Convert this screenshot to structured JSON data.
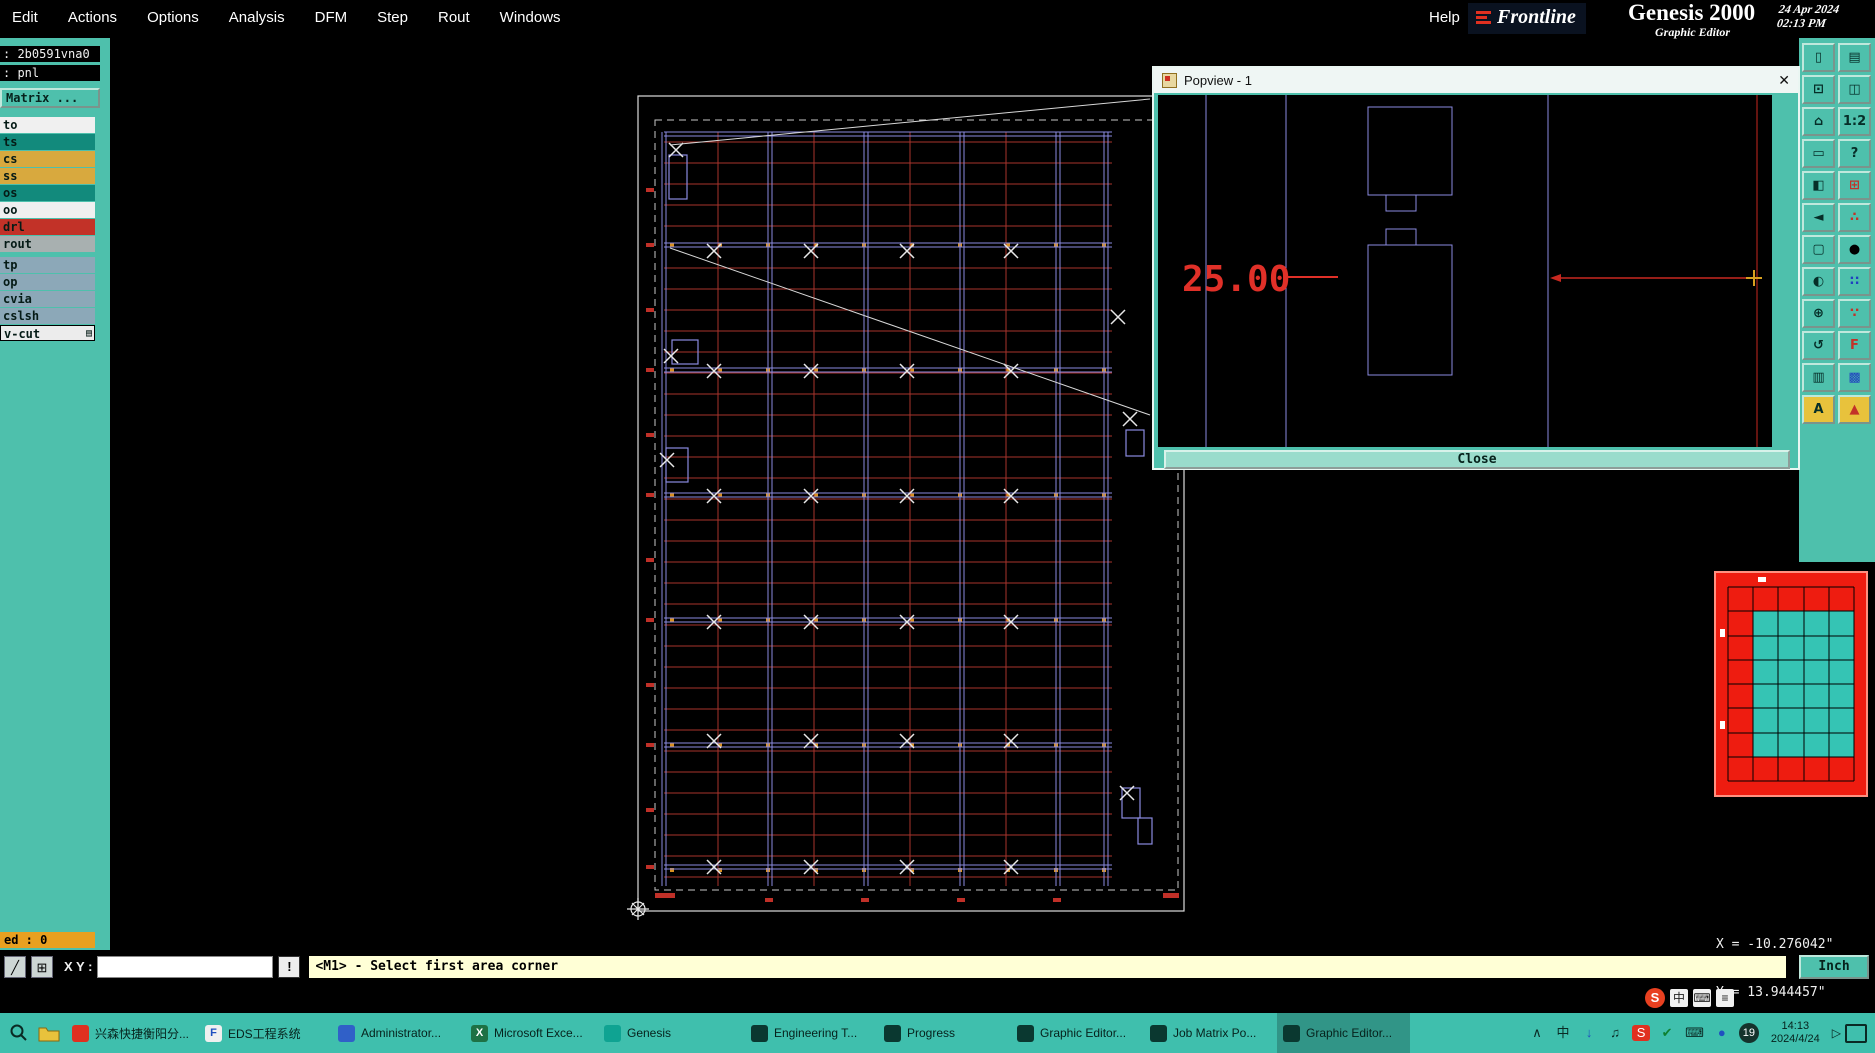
{
  "menu_bar": {
    "items": [
      "Edit",
      "Actions",
      "Options",
      "Analysis",
      "DFM",
      "Step",
      "Rout",
      "Windows"
    ],
    "help": "Help",
    "brand": "Frontline",
    "app_title": "Genesis 2000",
    "date": "24 Apr 2024",
    "time": "02:13 PM",
    "subtitle": "Graphic Editor"
  },
  "sidebar": {
    "job": ": 2b0591vna0",
    "step": ": pnl",
    "matrix_button": "Matrix ...",
    "layers": [
      {
        "label": "to",
        "bg": "#F0F0F0"
      },
      {
        "label": "ts",
        "bg": "#128A7C"
      },
      {
        "label": "cs",
        "bg": "#D8A93E"
      },
      {
        "label": "ss",
        "bg": "#D8A93E"
      },
      {
        "label": "os",
        "bg": "#128A7C"
      },
      {
        "label": "oo",
        "bg": "#F0F0F0"
      },
      {
        "label": "drl",
        "bg": "#C23228"
      },
      {
        "label": "rout",
        "bg": "#A8B0B0"
      },
      {
        "label": "tp",
        "bg": "#8CA8B8"
      },
      {
        "label": "op",
        "bg": "#8CA8B8"
      },
      {
        "label": "cvia",
        "bg": "#8CA8B8"
      },
      {
        "label": "cslsh",
        "bg": "#8CA8B8"
      },
      {
        "label": "v-cut",
        "bg": "#ECECEC"
      }
    ],
    "counter": "ed : 0"
  },
  "popview": {
    "title": "Popview - 1",
    "close_x": "✕",
    "dimension": "25.00",
    "close_button": "Close"
  },
  "status_bar": {
    "icons": [
      {
        "glyph": "╱"
      },
      {
        "glyph": "⊞"
      }
    ],
    "xy_label": "X Y :",
    "input_value": "",
    "alert": "!",
    "message": "<M1> - Select first area corner",
    "units": "Inch"
  },
  "coords": {
    "x": "X = -10.276042\"",
    "y": "Y = 13.944457\""
  },
  "right_toolbar": {
    "icons": [
      {
        "glyph": "▯",
        "fg": "#062E28"
      },
      {
        "glyph": "▤",
        "fg": "#062E28"
      },
      {
        "glyph": "⊡",
        "fg": "#062E28"
      },
      {
        "glyph": "◫",
        "fg": "#062E28"
      },
      {
        "glyph": "⌂",
        "fg": "#062E28"
      },
      {
        "glyph": "1:2",
        "fg": "#062E28"
      },
      {
        "glyph": "▭",
        "fg": "#062E28"
      },
      {
        "glyph": "?",
        "fg": "#062E28"
      },
      {
        "glyph": "◧",
        "fg": "#062E28"
      },
      {
        "glyph": "⊞",
        "fg": "#C23228"
      },
      {
        "glyph": "◄",
        "fg": "#062E28"
      },
      {
        "glyph": "∴",
        "fg": "#C23228"
      },
      {
        "glyph": "▢",
        "fg": "#062E28"
      },
      {
        "glyph": "●",
        "fg": "#000000"
      },
      {
        "glyph": "◐",
        "fg": "#062E28"
      },
      {
        "glyph": "∷",
        "fg": "#2040C0"
      },
      {
        "glyph": "⊕",
        "fg": "#062E28"
      },
      {
        "glyph": "∵",
        "fg": "#C23228"
      },
      {
        "glyph": "↺",
        "fg": "#062E28"
      },
      {
        "glyph": "F",
        "fg": "#C23228"
      },
      {
        "glyph": "▥",
        "fg": "#062E28"
      },
      {
        "glyph": "▩",
        "fg": "#2040C0"
      },
      {
        "glyph": "A",
        "fg": "#062E28",
        "bg": "#E8C23C"
      },
      {
        "glyph": "▲",
        "fg": "#C23228",
        "bg": "#E8C23C"
      }
    ]
  },
  "taskbar": {
    "items": [
      {
        "label": "兴森快捷衡阳分...",
        "icon_color": "#E03020",
        "icon_letter": "",
        "bg": "transparent"
      },
      {
        "label": "EDS工程系统",
        "icon_color": "#F0F0F0",
        "icon_letter": "F",
        "letter_color": "#2050C0",
        "bg": "transparent"
      },
      {
        "label": "Administrator...",
        "icon_color": "#3060C8",
        "icon_letter": "",
        "bg": "transparent"
      },
      {
        "label": "Microsoft Exce...",
        "icon_color": "#1E7145",
        "icon_letter": "X",
        "letter_color": "#FFFFFF",
        "bg": "transparent"
      },
      {
        "label": "Genesis",
        "icon_color": "#0FA392",
        "icon_letter": "",
        "bg": "transparent"
      },
      {
        "label": "Engineering T...",
        "icon_color": "#0A3830",
        "icon_letter": "",
        "bg": "transparent"
      },
      {
        "label": "Progress",
        "icon_color": "#0A3830",
        "icon_letter": "",
        "bg": "transparent"
      },
      {
        "label": "Graphic Editor...",
        "icon_color": "#0A3830",
        "icon_letter": "",
        "bg": "transparent"
      },
      {
        "label": "Job Matrix Po...",
        "icon_color": "#0A3830",
        "icon_letter": "",
        "bg": "transparent"
      },
      {
        "label": "Graphic Editor...",
        "icon_color": "#0A3830",
        "icon_letter": "",
        "bg": "rgba(0,0,0,0.22)"
      }
    ],
    "tray": [
      {
        "glyph": "∧",
        "fg": "#0A2A24",
        "bg": "transparent"
      },
      {
        "glyph": "中",
        "fg": "#0A2A24",
        "bg": "transparent"
      },
      {
        "glyph": "↓",
        "fg": "#2050C0",
        "bg": "transparent"
      },
      {
        "glyph": "♫",
        "fg": "#0A2A24",
        "bg": "transparent"
      },
      {
        "glyph": "S",
        "fg": "#FFFFFF",
        "bg": "#E03020"
      },
      {
        "glyph": "✔",
        "fg": "#0E8030",
        "bg": "transparent"
      },
      {
        "glyph": "⌨",
        "fg": "#0A2A24",
        "bg": "transparent"
      },
      {
        "glyph": "●",
        "fg": "#2050C0",
        "bg": "transparent"
      }
    ],
    "badge": "19",
    "time": "14:13",
    "date": "2024/4/24",
    "play": "▷"
  },
  "ime": {
    "logo": "S",
    "icons": [
      {
        "glyph": "中"
      },
      {
        "glyph": "⌨"
      },
      {
        "glyph": "≡"
      }
    ]
  },
  "colors": {
    "teal": "#4EC0AC",
    "grid_red": "#A8342C",
    "grid_purple": "#8A8AE0",
    "highlight_orange": "#E8A020"
  }
}
